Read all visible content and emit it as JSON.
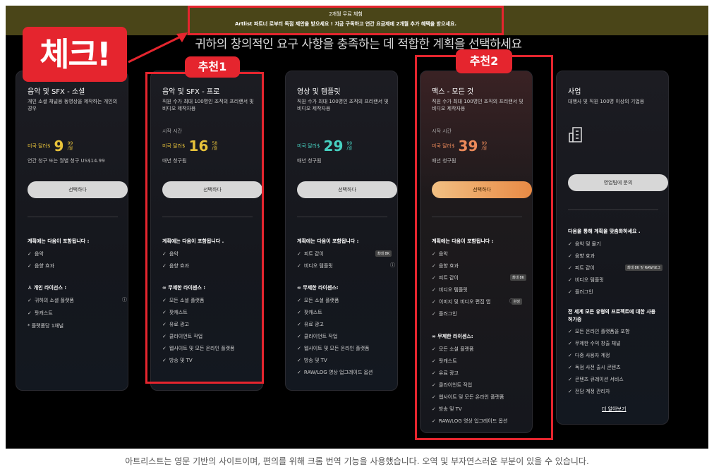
{
  "promo": {
    "line1": "2개월 무료 체험",
    "line2": "Artlist 파트너 로부터 독점 제안을 받으세요 ! 지금 구독하고 연간 요금제에 2개월 추가 혜택을 받으세요."
  },
  "headline": "귀하의 창의적인 요구 사항을 충족하는 데 적합한 계획을 선택하세요",
  "annotations": {
    "check": "체크!",
    "rec1": "추천1",
    "rec2": "추천2"
  },
  "plans": [
    {
      "title": "음악 및 SFX - 소셜",
      "desc": "개인 소셜 채널용 동영상을 제작하는 개인의 경우",
      "currency": "미국 달러$",
      "price_int": "9",
      "price_dec": "99",
      "per": "/월",
      "billing": "연간 청구 또는 월별 청구 US$14.99",
      "button": "선택하다",
      "includes_title": "계획에는 다음이 포함됩니다 :",
      "includes": [
        "음악",
        "음향 효과"
      ],
      "license_title": "개인 라이선스 :",
      "license_items": [
        "귀하의 소셜 플랫폼",
        "팟캐스트"
      ],
      "note": "* 플랫폼당 1채널"
    },
    {
      "title": "음악 및 SFX - 프로",
      "desc": "직원 수가 최대 100명인 조직의 프리랜서 및 비디오 제작자용",
      "from": "시작 시간",
      "currency": "미국 달러$",
      "price_int": "16",
      "price_dec": "58",
      "per": "/월",
      "billing": "매년 청구됨",
      "button": "선택하다",
      "includes_title": "계획에는 다음이 포함됩니다 .",
      "includes": [
        "음악",
        "음향 효과"
      ],
      "license_title": "무제한 라이센스 :",
      "license_items": [
        "모든 소셜 플랫폼",
        "팟캐스트",
        "유료 광고",
        "클라이언트 작업",
        "웹사이트 및 모든 온라인 플랫폼",
        "방송 및 TV"
      ]
    },
    {
      "title": "영상 및 템플릿",
      "desc": "직원 수가 최대 100명인 조직의 프리랜서 및 비디오 제작자용",
      "currency": "미국 달러$",
      "price_int": "29",
      "price_dec": "99",
      "per": "/월",
      "billing": "매년 청구됨",
      "button": "선택하다",
      "includes_title": "계획에는 다음이 포함됩니다 :",
      "includes": [
        "피트 같이",
        "비디오 템플릿"
      ],
      "badge": "최대 8K",
      "license_title": "무제한 라이센스:",
      "license_items": [
        "모든 소셜 플랫폼",
        "팟캐스트",
        "유료 광고",
        "클라이언트 작업",
        "웹사이트 및 모든 온라인 플랫폼",
        "방송 및 TV",
        "RAW/LOG 영상 업그레이드 옵션"
      ]
    },
    {
      "title": "맥스 - 모든 것",
      "desc": "직원 수가 최대 100명인 조직의 프리랜서 및 비디오 제작자용",
      "from": "시작 시간",
      "currency": "미국 달러$",
      "price_int": "39",
      "price_dec": "99",
      "per": "/월",
      "billing": "매년 청구됨",
      "button": "선택하다",
      "includes_title": "계획에는 다음이 포함됩니다 :",
      "includes": [
        "음악",
        "음향 효과",
        "피트 같이",
        "비디오 템플릿",
        "이미지 및 비디오 편집 앱",
        "플러그인"
      ],
      "badge": "최대 8K",
      "app_badge": "완성",
      "license_title": "무제한 라이센스:",
      "license_items": [
        "모든 소셜 플랫폼",
        "팟캐스트",
        "유료 광고",
        "클라이언트 작업",
        "웹사이트 및 모든 온라인 플랫폼",
        "방송 및 TV",
        "RAW/LOG 영상 업그레이드 옵션"
      ]
    },
    {
      "title": "사업",
      "desc": "대행사 및 직원 100명 이상의 기업용",
      "button": "영업팀에 문의",
      "includes_title": "다음을 통해 계획을 맞춤화하세요 .",
      "includes": [
        "음악 및 물기",
        "음향 효과",
        "피트 같이",
        "비디오 템플릿",
        "플러그인"
      ],
      "badge": "최대 8K 및 RAW/로그",
      "license_title": "전 세계 모든 유형의 프로젝트에 대한 사용 허가증",
      "license_items": [
        "모든 온라인 플랫폼을 포함",
        "무제한 수익 창출 채널",
        "다중 사용자 계정",
        "독점 사전 출시 콘텐츠",
        "콘텐츠 큐레이션 서비스",
        "전담 계정 관리자"
      ],
      "link": "더 알아보기"
    }
  ],
  "caption": "아트리스트는 영문 기반의 사이트이며, 편의를 위해 크롬 번역 기능을 사용했습니다. 오역 및 부자연스러운 부분이 있을 수 있습니다.",
  "colors": {
    "annotation_red": "#e5252e",
    "price_gold": "#e8c33a",
    "price_teal": "#47d1c1",
    "accent_orange": "#e88a45"
  }
}
